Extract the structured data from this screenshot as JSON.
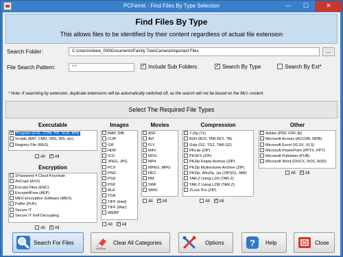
{
  "window": {
    "title": "PCFerret - Find Files By Type Selection",
    "min_label": "—",
    "max_label": "☐",
    "close_label": "✕"
  },
  "header": {
    "title": "Find Files By Type",
    "subtitle": "This allows files to be identified by their content regardless of actual file extension"
  },
  "search": {
    "folder_label": "Search Folder:",
    "folder_value": "C:\\Users\\mikew_000\\Documents\\Family Tree\\Camera\\Important Files",
    "browse_label": "...",
    "pattern_label": "File Search Pattern:",
    "pattern_value": "*.*",
    "options": [
      {
        "label": "Include Sub Folders",
        "checked": true
      },
      {
        "label": "Search By Type",
        "checked": true
      },
      {
        "label": "Search By Ext*",
        "checked": false
      }
    ],
    "note": "* Note: If searching by extension, duplicate extensions will be automatically switched off, as the search will not be based on the file's content."
  },
  "select_header": "Select The Required File Types",
  "all_label": "All",
  "groups": {
    "executable": {
      "title": "Executable",
      "items": [
        {
          "label": "Program (EXE, COM, PIF, SCR, BIN)",
          "checked": true,
          "selected": true
        },
        {
          "label": "Scripts (BAT, CMD, VBS, WS, etc)",
          "checked": false
        },
        {
          "label": "Registry File (REG)",
          "checked": false
        }
      ],
      "all_unchecked": false,
      "all_checked": true
    },
    "encryption": {
      "title": "Encryption",
      "items": [
        {
          "label": "1Password 4 Cloud Keychain",
          "checked": false
        },
        {
          "label": "AxCrypt (AXX)",
          "checked": false
        },
        {
          "label": "Encrypt Files (ENC)",
          "checked": false
        },
        {
          "label": "Encrypt4Free (AEP)",
          "checked": false
        },
        {
          "label": "MEO Encryption Software (MEO)",
          "checked": false
        },
        {
          "label": "Puffer (PUF)",
          "checked": false
        },
        {
          "label": "Secure IT",
          "checked": false
        },
        {
          "label": "Secure IT-Self Decrypting",
          "checked": false
        }
      ],
      "all_unchecked": false,
      "all_checked": true
    },
    "images": {
      "title": "Images",
      "items": [
        {
          "label": "BMP, DIB",
          "checked": false
        },
        {
          "label": "CUR",
          "checked": false
        },
        {
          "label": "GIF",
          "checked": false
        },
        {
          "label": "HDR",
          "checked": false
        },
        {
          "label": "ICO",
          "checked": false
        },
        {
          "label": "JPEG, JPG",
          "checked": false
        },
        {
          "label": "PCX",
          "checked": false
        },
        {
          "label": "PNG",
          "checked": false
        },
        {
          "label": "PSD",
          "checked": false
        },
        {
          "label": "PSP",
          "checked": false
        },
        {
          "label": "RLE",
          "checked": false
        },
        {
          "label": "TGA",
          "checked": false
        },
        {
          "label": "TIFF (Intel)",
          "checked": false
        },
        {
          "label": "TIFF (Mac)",
          "checked": false
        },
        {
          "label": "WEBP",
          "checked": false
        }
      ],
      "all_unchecked": false,
      "all_checked": true
    },
    "movies": {
      "title": "Movies",
      "items": [
        {
          "label": "ASF",
          "checked": false
        },
        {
          "label": "AVI",
          "checked": false
        },
        {
          "label": "FLV",
          "checked": false
        },
        {
          "label": "M4V",
          "checked": false
        },
        {
          "label": "MOV",
          "checked": false
        },
        {
          "label": "MP4",
          "checked": false
        },
        {
          "label": "MPEG, MPG",
          "checked": false
        },
        {
          "label": "REC",
          "checked": false
        },
        {
          "label": "RM",
          "checked": false
        },
        {
          "label": "SWF",
          "checked": false
        },
        {
          "label": "WMV",
          "checked": false
        }
      ],
      "all_unchecked": false,
      "all_checked": true
    },
    "compression": {
      "title": "Compression",
      "items": [
        {
          "label": "7-Zip (7z)",
          "checked": false
        },
        {
          "label": "BZH (BZ2, TAR.BZ2, TB)",
          "checked": false
        },
        {
          "label": "Gzip (GZ, TGZ, TAR.GZ)",
          "checked": false
        },
        {
          "label": "PKLite (ZIP)",
          "checked": false
        },
        {
          "label": "PKSFX (ZIP)",
          "checked": false
        },
        {
          "label": "PKZip Empty Archive (ZIP)",
          "checked": false
        },
        {
          "label": "PKZip Multivolume Archive (ZIP)",
          "checked": false
        },
        {
          "label": "PKZip, WinZip, Jar (ZIP)(X), JAR)",
          "checked": false
        },
        {
          "label": "TAR.Z Using LZH (TAR.Z)",
          "checked": false
        },
        {
          "label": "TAR.Z Using LZW (TAR.Z)",
          "checked": false
        },
        {
          "label": "ZLock Pro (ZIP)",
          "checked": false
        }
      ],
      "all_unchecked": false,
      "all_checked": true
    },
    "other": {
      "title": "Other",
      "items": [
        {
          "label": "Adobe (PDF, FDF, AI)",
          "checked": false
        },
        {
          "label": "Microsoft Access (ACCDB, MDB)",
          "checked": false
        },
        {
          "label": "Microsoft Excel (XLSX, XLS)",
          "checked": false
        },
        {
          "label": "Microsoft PowerPoint (PPTX, PPT)",
          "checked": false
        },
        {
          "label": "Microsoft Publisher (PUB)",
          "checked": false
        },
        {
          "label": "Microsoft Word (DOCX, DOC, ASD)",
          "checked": false
        }
      ],
      "all_unchecked": false,
      "all_checked": true
    }
  },
  "buttons": {
    "search": {
      "label": "Search For Files",
      "icon": "magnifier-icon"
    },
    "clear": {
      "label": "Clear All Categories",
      "icon": "eraser-icon"
    },
    "options": {
      "label": "Options",
      "icon": "tools-icon"
    },
    "help": {
      "label": "Help",
      "icon": "help-icon"
    },
    "close": {
      "label": "Close",
      "icon": "exit-icon"
    }
  }
}
